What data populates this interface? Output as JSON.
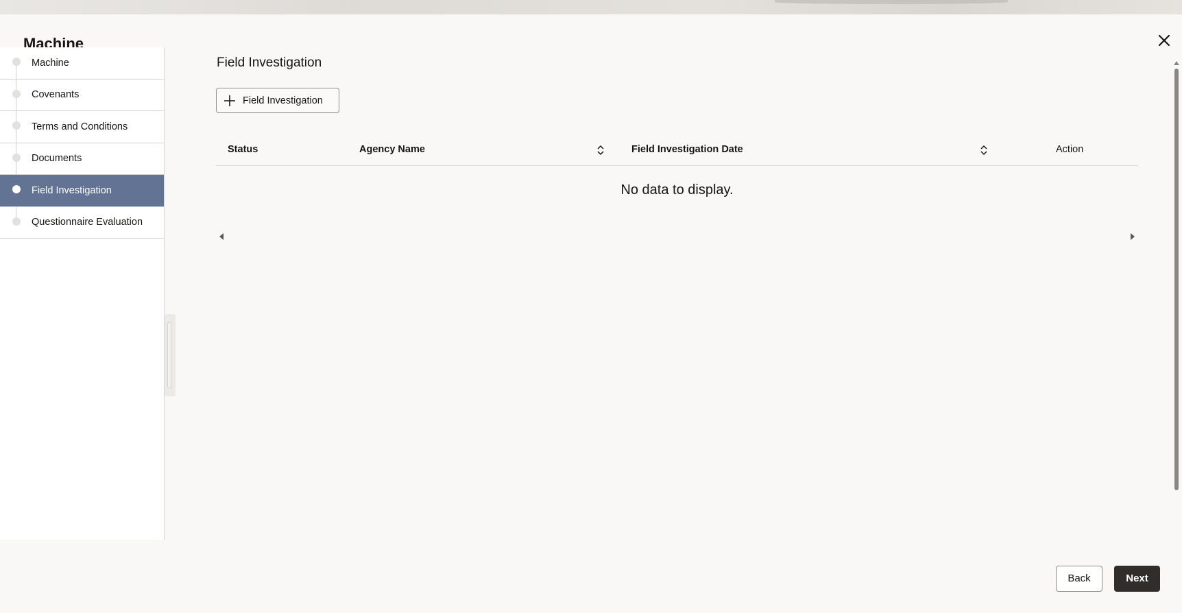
{
  "dialog": {
    "title": "Machine",
    "close_icon": "close-icon"
  },
  "sidebar": {
    "items": [
      {
        "label": "Machine",
        "active": false
      },
      {
        "label": "Covenants",
        "active": false
      },
      {
        "label": "Terms and Conditions",
        "active": false
      },
      {
        "label": "Documents",
        "active": false
      },
      {
        "label": "Field Investigation",
        "active": true
      },
      {
        "label": "Questionnaire Evaluation",
        "active": false
      }
    ],
    "active_color": "#637394"
  },
  "main": {
    "title": "Field Investigation",
    "add_button_label": "Field Investigation",
    "add_button_icon": "plus-icon",
    "table": {
      "columns": [
        "Status",
        "Agency Name",
        "Field Investigation Date",
        "Action"
      ],
      "rows": [],
      "empty_message": "No data to display."
    }
  },
  "footer": {
    "back_label": "Back",
    "next_label": "Next",
    "next_color": "#302d2a"
  }
}
